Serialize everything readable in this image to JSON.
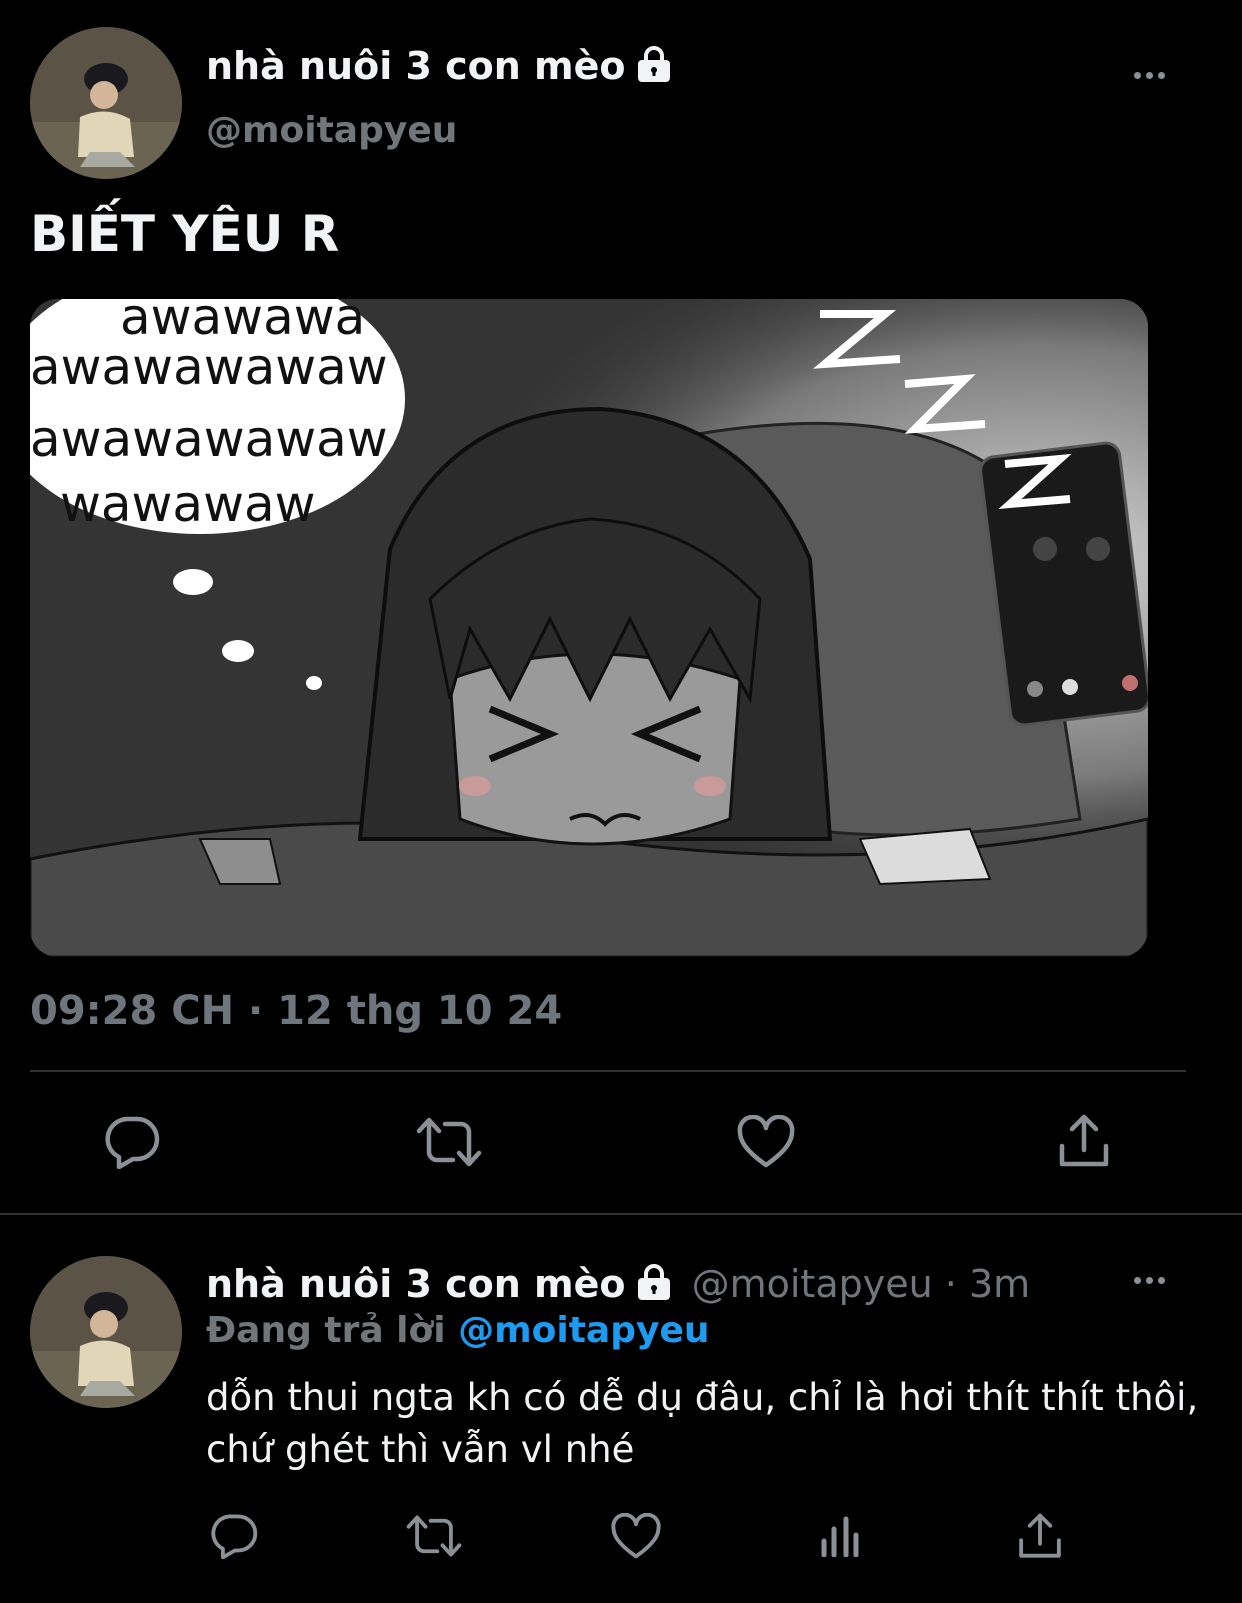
{
  "tweet": {
    "author_name": "nhà nuôi 3 con mèo",
    "author_handle": "@moitapyeu",
    "text": "BIẾT YÊU R",
    "media_texts": [
      "awawawa",
      "awawawawaw",
      "awawawawaw",
      "wawawaw"
    ],
    "time": "09:28 CH",
    "date_separator": "·",
    "date": "12 thg 10 24"
  },
  "reply": {
    "author_name": "nhà nuôi 3 con mèo",
    "author_handle": "@moitapyeu",
    "time_separator": "·",
    "time": "3m",
    "replying_prefix": "Đang trả lời",
    "replying_to": "@moitapyeu",
    "text": "dỗn thui ngta kh có dễ dụ đâu, chỉ là hơi thít thít thôi, chứ ghét thì vẫn vl nhé"
  },
  "icons": {
    "lock": "lock-icon",
    "more": "more-icon",
    "reply": "reply-icon",
    "retweet": "retweet-icon",
    "like": "like-icon",
    "share": "share-icon",
    "analytics": "analytics-icon"
  },
  "colors": {
    "background": "#000000",
    "text": "#f2f3f4",
    "muted": "#71767b",
    "mention": "#1d9bf0",
    "divider": "#2f3336"
  }
}
